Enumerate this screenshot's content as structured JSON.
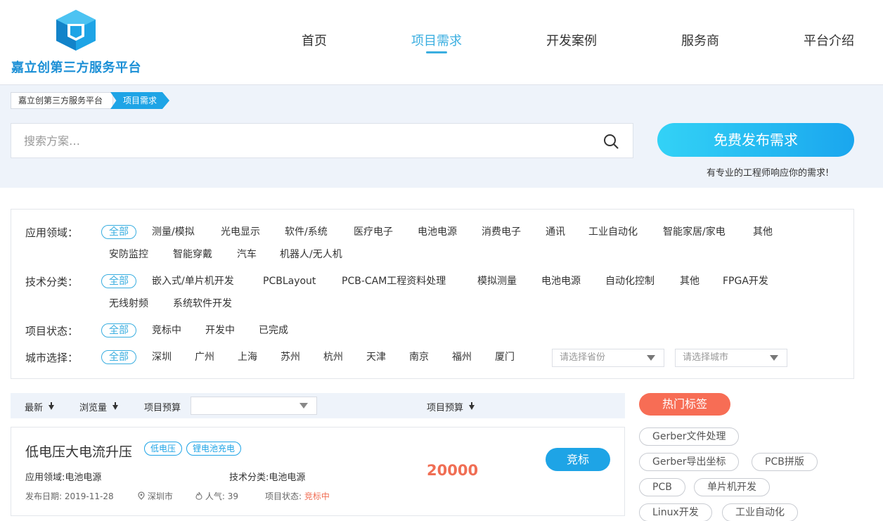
{
  "brand": {
    "name": "嘉立创第三方服务平台"
  },
  "nav": [
    {
      "label": "首页"
    },
    {
      "label": "项目需求"
    },
    {
      "label": "开发案例"
    },
    {
      "label": "服务商"
    },
    {
      "label": "平台介绍"
    }
  ],
  "breadcrumb": {
    "home": "嘉立创第三方服务平台",
    "current": "项目需求"
  },
  "search": {
    "placeholder": "搜索方案…",
    "value": ""
  },
  "publish": {
    "label": "免费发布需求",
    "tip": "有专业的工程师响应你的需求!"
  },
  "filters": {
    "field": {
      "label": "应用领域：",
      "options": [
        "全部",
        "测量/模拟",
        "光电显示",
        "软件/系统",
        "医疗电子",
        "电池电源",
        "消费电子",
        "通讯",
        "工业自动化",
        "智能家居/家电",
        "其他",
        "安防监控",
        "智能穿戴",
        "汽车",
        "机器人/无人机"
      ]
    },
    "tech": {
      "label": "技术分类：",
      "options": [
        "全部",
        "嵌入式/单片机开发",
        "PCBLayout",
        "PCB-CAM工程资料处理",
        "模拟测量",
        "电池电源",
        "自动化控制",
        "其他",
        "FPGA开发",
        "无线射频",
        "系统软件开发"
      ]
    },
    "status": {
      "label": "项目状态：",
      "options": [
        "全部",
        "竞标中",
        "开发中",
        "已完成"
      ]
    },
    "city": {
      "label": "城市选择：",
      "options": [
        "全部",
        "深圳",
        "广州",
        "上海",
        "苏州",
        "杭州",
        "天津",
        "南京",
        "福州",
        "厦门"
      ],
      "province_placeholder": "请选择省份",
      "city_placeholder": "请选择城市"
    }
  },
  "sortbar": {
    "latest": "最新",
    "views": "浏览量",
    "budget_label": "项目预算",
    "budget_sort": "项目预算"
  },
  "project": {
    "title": "低电压大电流升压",
    "tags": [
      "低电压",
      "锂电池充电"
    ],
    "field_label": "应用领域:",
    "field_value": "电池电源",
    "tech_label": "技术分类:",
    "tech_value": "电池电源",
    "date_label": "发布日期:",
    "date_value": "2019-11-28",
    "city": "深圳市",
    "views_label": "人气:",
    "views_value": "39",
    "status_label": "项目状态:",
    "status_value": "竞标中",
    "budget": "20000",
    "bid_label": "竞标"
  },
  "hot_tags": {
    "title": "热门标签",
    "items": [
      "Gerber文件处理",
      "Gerber导出坐标",
      "PCB拼版",
      "PCB",
      "单片机开发",
      "Linux开发",
      "工业自动化"
    ]
  },
  "colors": {
    "accent": "#3aaee0",
    "brand": "#1ea4e6",
    "hot": "#f76d55",
    "price": "#f06e54"
  }
}
